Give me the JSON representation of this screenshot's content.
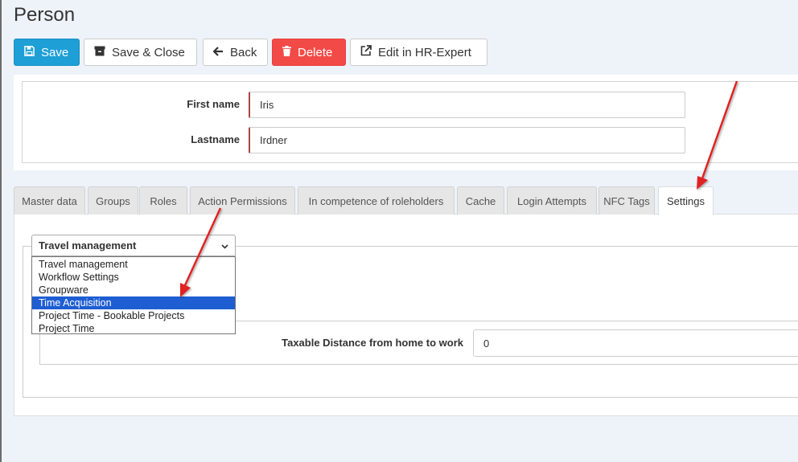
{
  "page": {
    "title": "Person"
  },
  "toolbar": {
    "save_label": "Save",
    "save_close_label": "Save & Close",
    "back_label": "Back",
    "delete_label": "Delete",
    "edit_hr_label": "Edit in HR-Expert"
  },
  "form": {
    "first_name_label": "First name",
    "first_name_value": "Iris",
    "lastname_label": "Lastname",
    "lastname_value": "Irdner"
  },
  "tabs": [
    {
      "label": "Master data"
    },
    {
      "label": "Groups"
    },
    {
      "label": "Roles"
    },
    {
      "label": "Action Permissions"
    },
    {
      "label": "In competence of roleholders"
    },
    {
      "label": "Cache"
    },
    {
      "label": "Login Attempts"
    },
    {
      "label": "NFC Tags"
    },
    {
      "label": "Settings",
      "active": true
    }
  ],
  "settings": {
    "selected_category": "Travel management",
    "options": [
      "Travel management",
      "Workflow Settings",
      "Groupware",
      "Time Acquisition",
      "Project Time - Bookable Projects",
      "Project Time"
    ],
    "highlighted_option": "Time Acquisition",
    "taxable_label": "Taxable Distance from home to work",
    "taxable_value": "0"
  },
  "colors": {
    "primary": "#1e9fd6",
    "danger": "#f24b47",
    "annotation_arrow": "#e02020",
    "highlight": "#1e5dd2",
    "background": "#eef3f9"
  },
  "icons": {
    "save": "floppy-disk-icon",
    "save_close": "archive-box-icon",
    "back": "arrow-left-icon",
    "delete": "trash-icon",
    "edit_hr": "external-link-icon",
    "select": "chevron-down-icon"
  }
}
